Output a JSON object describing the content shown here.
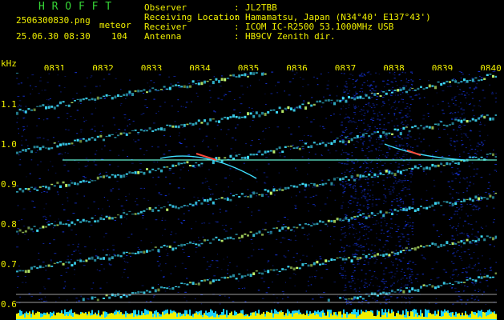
{
  "header": {
    "title": "H R O F F T",
    "filename": "2506300830.png",
    "kind": "meteor",
    "datetime": "25.06.30 08:30",
    "count": "104",
    "fields": [
      {
        "label": "Observer",
        "value": "JL2TBB"
      },
      {
        "label": "Receiving Location",
        "value": "Hamamatsu, Japan (N34°40' E137°43')"
      },
      {
        "label": "Receiver",
        "value": "ICOM IC-R2500 53.1000MHz USB"
      },
      {
        "label": "Antenna",
        "value": "HB9CV Zenith dir."
      }
    ]
  },
  "spectrogram": {
    "y_unit": "kHz",
    "y_ticks": [
      "1.1",
      "1.0",
      "0.9",
      "0.8",
      "0.7",
      "0.6"
    ],
    "x_ticks": [
      "0831",
      "0832",
      "0833",
      "0834",
      "0835",
      "0836",
      "0837",
      "0838",
      "0839",
      "0840"
    ],
    "colors": {
      "background": "#000000",
      "noise": "#1a3cff",
      "signal": "#3fe0ff",
      "peak": "#ff4a3a",
      "ref_line": "#5ff0d0",
      "baseline_bar": "#f0f000",
      "baseline_fill": "#1ad0ff",
      "label": "#f0f000"
    }
  }
}
